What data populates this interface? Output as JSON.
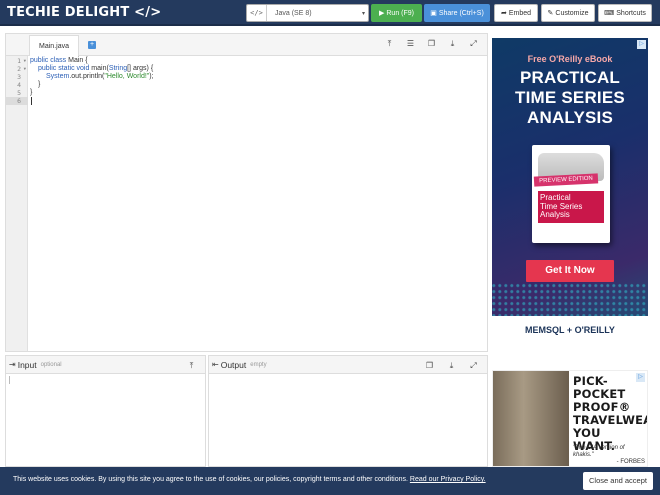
{
  "header": {
    "logo": "TECHIE DELIGHT </>",
    "language_icon": "</>",
    "language": "Java (SE 8)",
    "run_label": "Run (F9)",
    "share_label": "Share (Ctrl+S)",
    "embed_label": "Embed",
    "customize_label": "Customize",
    "shortcuts_label": "Shortcuts",
    "colors": {
      "bar": "#243a5e",
      "run": "#4caf50",
      "share": "#4a90d9"
    }
  },
  "editor": {
    "tab": "Main.java",
    "add_tab": "+",
    "icons": [
      "upload-icon",
      "format-icon",
      "copy-icon",
      "download-icon",
      "expand-icon"
    ],
    "line_numbers": [
      "1",
      "2",
      "3",
      "4",
      "5",
      "6"
    ],
    "code": {
      "l1_kw": "public class",
      "l1_rest": " Main {",
      "l2_kw": "public static void",
      "l2_mid": " main(",
      "l2_type": "String",
      "l2_rest": "[] args) {",
      "l3_obj": "System",
      "l3_mid": ".out.println(",
      "l3_str": "\"Hello, World!\"",
      "l3_rest": ");",
      "l4": "}",
      "l5": "}"
    }
  },
  "input": {
    "title": "Input",
    "subtitle": "optional"
  },
  "output": {
    "title": "Output",
    "subtitle": "empty"
  },
  "ad1": {
    "free": "Free O'Reilly eBook",
    "headline_1": "PRACTICAL",
    "headline_2": "TIME SERIES",
    "headline_3": "ANALYSIS",
    "edition": "PREVIEW EDITION",
    "book_title_1": "Practical",
    "book_title_2": "Time Series",
    "book_title_3": "Analysis",
    "cta": "Get It Now",
    "brand": "MEMSQL + O'REILLY"
  },
  "ad2": {
    "line1": "PICK-POCKET",
    "line2": "PROOF®",
    "line3": "TRAVELWEAR",
    "line4": "YOU WANT.",
    "quote": "\"The CIA version of khakis.\"",
    "source": "- FORBES"
  },
  "cookie": {
    "message": "This website uses cookies. By using this site you agree to the use of cookies, our policies, copyright terms and other conditions.",
    "link": "Read our Privacy Policy.",
    "accept": "Close and accept"
  }
}
